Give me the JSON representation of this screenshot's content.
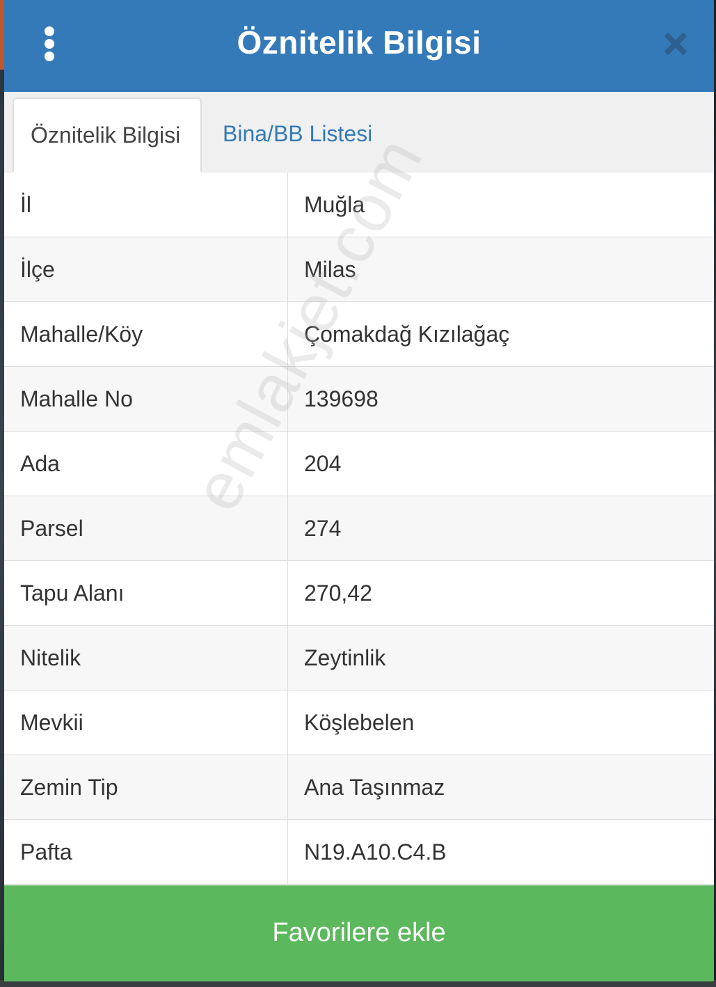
{
  "header": {
    "title": "Öznitelik Bilgisi",
    "menu_icon": "more-vertical-icon",
    "close_icon": "close-icon",
    "background_color": "#357ab8"
  },
  "tabs": [
    {
      "label": "Öznitelik Bilgisi",
      "active": true
    },
    {
      "label": "Bina/BB Listesi",
      "active": false
    }
  ],
  "attributes": [
    {
      "label": "İl",
      "value": "Muğla"
    },
    {
      "label": "İlçe",
      "value": "Milas"
    },
    {
      "label": "Mahalle/Köy",
      "value": "Çomakdağ Kızılağaç"
    },
    {
      "label": "Mahalle No",
      "value": "139698"
    },
    {
      "label": "Ada",
      "value": "204"
    },
    {
      "label": "Parsel",
      "value": "274"
    },
    {
      "label": "Tapu Alanı",
      "value": "270,42"
    },
    {
      "label": "Nitelik",
      "value": "Zeytinlik"
    },
    {
      "label": "Mevkii",
      "value": "Köşlebelen"
    },
    {
      "label": "Zemin Tip",
      "value": "Ana Taşınmaz"
    },
    {
      "label": "Pafta",
      "value": "N19.A10.C4.B"
    }
  ],
  "watermark": "emlakjet.com",
  "footer": {
    "button_label": "Favorilere ekle",
    "button_color": "#5cb85c"
  }
}
